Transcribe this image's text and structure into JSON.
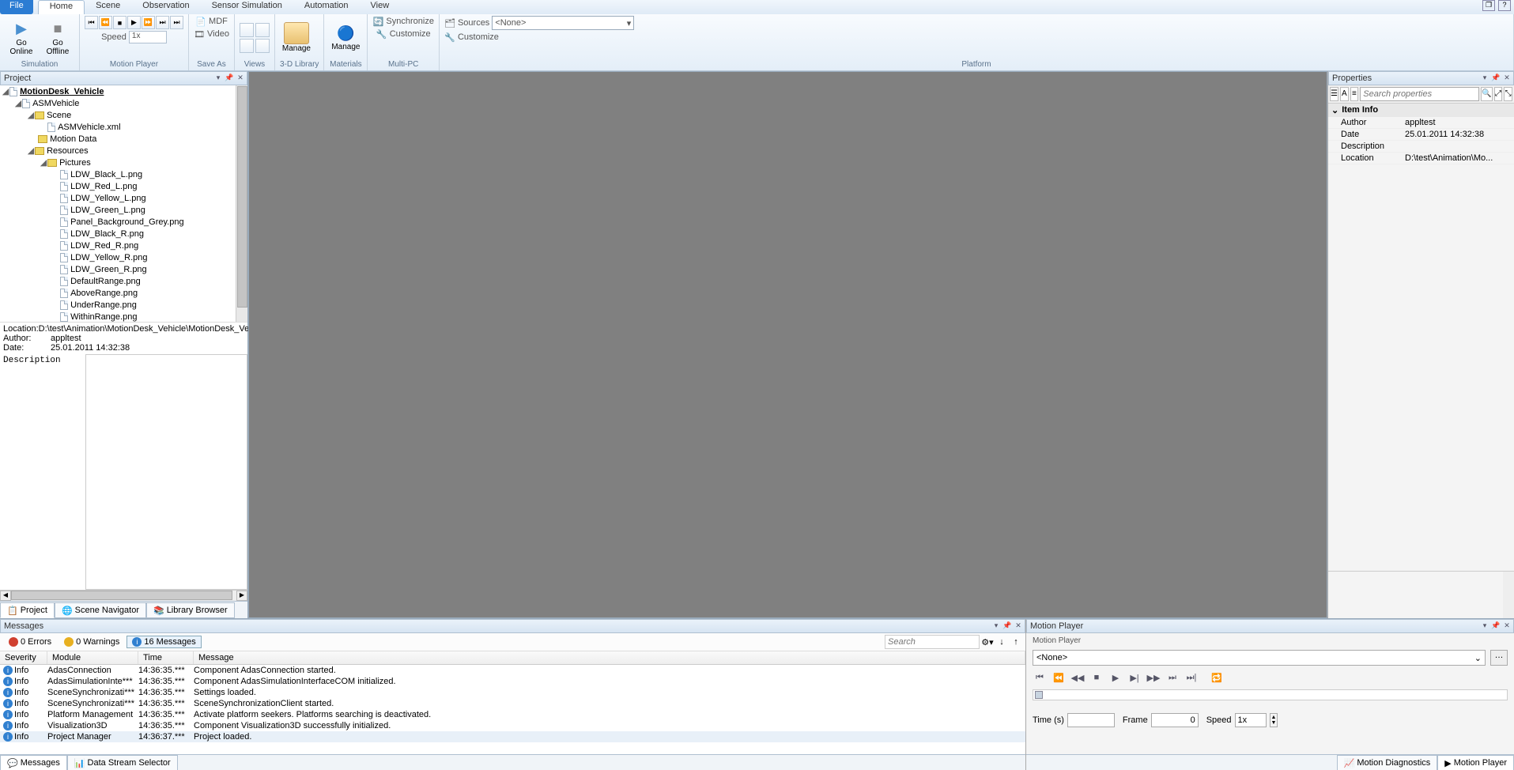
{
  "tabs": {
    "file": "File",
    "items": [
      "Home",
      "Scene",
      "Observation",
      "Sensor Simulation",
      "Automation",
      "View"
    ],
    "active": 0
  },
  "ribbon": {
    "simulation": {
      "label": "Simulation",
      "go_online": "Go\nOnline",
      "go_offline": "Go\nOffline"
    },
    "motion_player": {
      "label": "Motion Player",
      "speed_lbl": "Speed",
      "speed_val": "1x"
    },
    "save_as": {
      "label": "Save As",
      "mdf": "MDF",
      "video": "Video"
    },
    "views": {
      "label": "Views"
    },
    "library_3d": {
      "label": "3-D Library",
      "manage": "Manage"
    },
    "materials": {
      "label": "Materials",
      "manage": "Manage"
    },
    "multi_pc": {
      "label": "Multi-PC",
      "sync": "Synchronize",
      "cust": "Customize"
    },
    "platform": {
      "label": "Platform",
      "sources_lbl": "Sources",
      "sources_val": "<None>",
      "cust": "Customize"
    }
  },
  "project": {
    "title": "Project",
    "root": "MotionDesk_Vehicle",
    "nodes": {
      "asm": "ASMVehicle",
      "scene": "Scene",
      "xml": "ASMVehicle.xml",
      "motion_data": "Motion Data",
      "resources": "Resources",
      "pictures": "Pictures",
      "files": [
        "LDW_Black_L.png",
        "LDW_Red_L.png",
        "LDW_Yellow_L.png",
        "LDW_Green_L.png",
        "Panel_Background_Grey.png",
        "LDW_Black_R.png",
        "LDW_Red_R.png",
        "LDW_Yellow_R.png",
        "LDW_Green_R.png",
        "DefaultRange.png",
        "AboveRange.png",
        "UnderRange.png",
        "WithinRange.png"
      ]
    },
    "meta": {
      "location_k": "Location:",
      "location_v": "D:\\test\\Animation\\MotionDesk_Vehicle\\MotionDesk_Vehic…",
      "author_k": "Author:",
      "author_v": "appltest",
      "date_k": "Date:",
      "date_v": "25.01.2011 14:32:38",
      "desc_k": "Description"
    },
    "tabs": [
      "Project",
      "Scene Navigator",
      "Library Browser"
    ]
  },
  "properties": {
    "title": "Properties",
    "search_ph": "Search properties",
    "section": "Item Info",
    "rows": [
      {
        "k": "Author",
        "v": "appltest"
      },
      {
        "k": "Date",
        "v": "25.01.2011 14:32:38"
      },
      {
        "k": "Description",
        "v": ""
      },
      {
        "k": "Location",
        "v": "D:\\test\\Animation\\Mo..."
      }
    ]
  },
  "messages": {
    "title": "Messages",
    "errors": "0 Errors",
    "warnings": "0 Warnings",
    "infos": "16 Messages",
    "search_ph": "Search",
    "headers": [
      "Severity",
      "Module",
      "Time",
      "Message"
    ],
    "rows": [
      {
        "sev": "Info",
        "mod": "AdasConnection",
        "time": "14:36:35.***",
        "msg": "Component AdasConnection started."
      },
      {
        "sev": "Info",
        "mod": "AdasSimulationInte***",
        "time": "14:36:35.***",
        "msg": "Component AdasSimulationInterfaceCOM initialized."
      },
      {
        "sev": "Info",
        "mod": "SceneSynchronizati***",
        "time": "14:36:35.***",
        "msg": "Settings loaded."
      },
      {
        "sev": "Info",
        "mod": "SceneSynchronizati***",
        "time": "14:36:35.***",
        "msg": "SceneSynchronizationClient started."
      },
      {
        "sev": "Info",
        "mod": "Platform Management",
        "time": "14:36:35.***",
        "msg": "Activate platform seekers. Platforms searching is deactivated."
      },
      {
        "sev": "Info",
        "mod": "Visualization3D",
        "time": "14:36:35.***",
        "msg": "Component Visualization3D successfully initialized."
      },
      {
        "sev": "Info",
        "mod": "Project Manager",
        "time": "14:36:37.***",
        "msg": "Project loaded."
      }
    ],
    "tabs": [
      "Messages",
      "Data Stream Selector"
    ]
  },
  "motion_player": {
    "title": "Motion Player",
    "sub": "Motion Player",
    "combo": "<None>",
    "time_lbl": "Time (s)",
    "time_val": "",
    "frame_lbl": "Frame",
    "frame_val": "0",
    "speed_lbl": "Speed",
    "speed_val": "1x",
    "tabs": [
      "Motion Diagnostics",
      "Motion Player"
    ]
  }
}
